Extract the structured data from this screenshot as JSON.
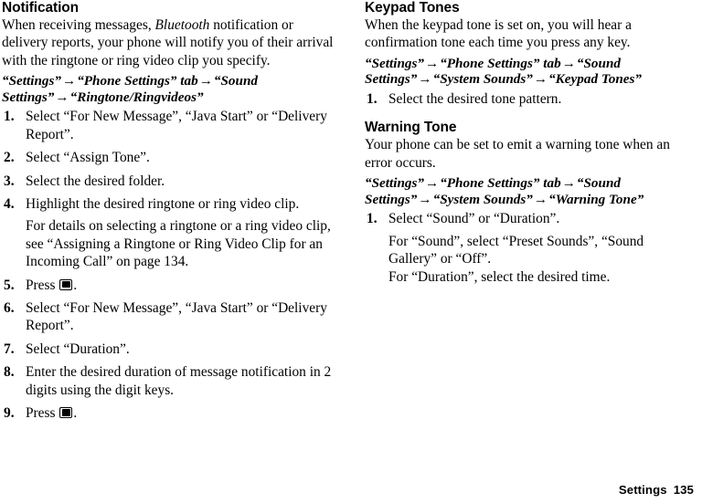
{
  "page": {
    "footer": {
      "chapter": "Settings",
      "page_number": "135"
    }
  },
  "left_column": {
    "sections": [
      {
        "heading": "Notification",
        "intro_before_italic": "When receiving messages, ",
        "intro_italic": "Bluetooth",
        "intro_after_italic": " notification or delivery reports, your phone will notify you of their arrival with the ringtone or ring video clip you specify.",
        "nav_path": {
          "part1": "“Settings”",
          "arrow1": "→",
          "part2": "“Phone Settings” tab",
          "arrow2": "→",
          "part3": "“Sound Settings”",
          "arrow3": "→",
          "part4": "“Ringtone/Ringvideos”"
        },
        "steps": [
          {
            "num": "1.",
            "text": "Select “For New Message”, “Java Start” or “Delivery Report”."
          },
          {
            "num": "2.",
            "text": "Select “Assign Tone”."
          },
          {
            "num": "3.",
            "text": "Select the desired folder."
          },
          {
            "num": "4.",
            "text": "Highlight the desired ringtone or ring video clip.",
            "note": "For details on selecting a ringtone or a ring video clip, see “Assigning a Ringtone or Ring Video Clip for an Incoming Call” on page 134."
          },
          {
            "num": "5.",
            "text_before_icon": "Press ",
            "icon": "center-key-icon",
            "text_after_icon": "."
          },
          {
            "num": "6.",
            "text": "Select “For New Message”, “Java Start” or “Delivery Report”."
          },
          {
            "num": "7.",
            "text": "Select “Duration”."
          },
          {
            "num": "8.",
            "text": "Enter the desired duration of message notification in 2 digits using the digit keys."
          },
          {
            "num": "9.",
            "text_before_icon": "Press ",
            "icon": "center-key-icon",
            "text_after_icon": "."
          }
        ]
      }
    ]
  },
  "right_column": {
    "sections": [
      {
        "heading": "Keypad Tones",
        "intro": "When the keypad tone is set on, you will hear a confirmation tone each time you press any key.",
        "nav_path": {
          "part1": "“Settings”",
          "arrow1": "→",
          "part2": "“Phone Settings” tab",
          "arrow2": "→",
          "part3": "“Sound Settings”",
          "arrow3": "→",
          "part4": "“System Sounds”",
          "arrow4": "→",
          "part5": "“Keypad Tones”"
        },
        "steps": [
          {
            "num": "1.",
            "text": "Select the desired tone pattern."
          }
        ]
      },
      {
        "heading": "Warning Tone",
        "intro": "Your phone can be set to emit a warning tone when an error occurs.",
        "nav_path": {
          "part1": "“Settings”",
          "arrow1": "→",
          "part2": "“Phone Settings” tab",
          "arrow2": "→",
          "part3": "“Sound Settings”",
          "arrow3": "→",
          "part4": "“System Sounds”",
          "arrow4": "→",
          "part5": "“Warning Tone”"
        },
        "steps": [
          {
            "num": "1.",
            "text": "Select “Sound” or “Duration”.",
            "note": "For “Sound”, select “Preset Sounds”, “Sound Gallery” or “Off”.",
            "note2": "For “Duration”, select the desired time."
          }
        ]
      }
    ]
  }
}
